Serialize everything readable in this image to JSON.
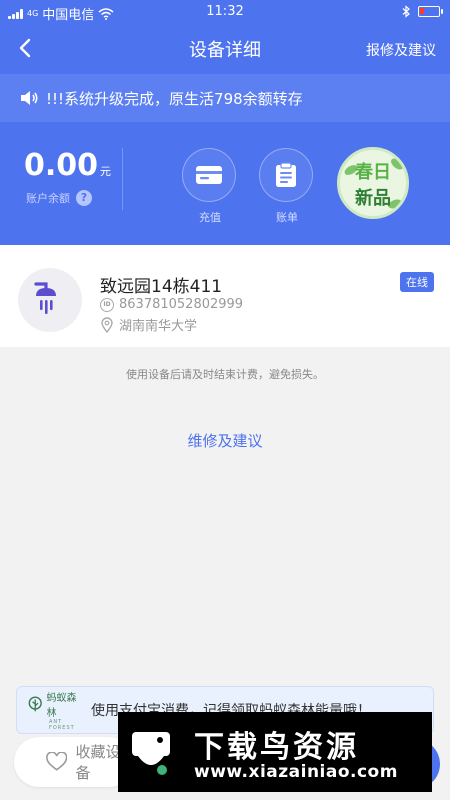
{
  "status_bar": {
    "network": "4G",
    "carrier": "中国电信",
    "time": "11:32"
  },
  "nav": {
    "title": "设备详细",
    "repair_link": "报修及建议"
  },
  "notice": {
    "text": "!!!系统升级完成，原生活798余额转存"
  },
  "wallet": {
    "amount": "0.00",
    "unit": "元",
    "balance_label": "账户余额",
    "help": "?",
    "actions": [
      {
        "label": "充值",
        "icon": "card-icon"
      },
      {
        "label": "账单",
        "icon": "clipboard-icon"
      }
    ],
    "promo": {
      "line1": "春日",
      "line2": "新品"
    }
  },
  "device": {
    "name": "致远园14栋411",
    "status": "在线",
    "id_tag": "ID",
    "id": "863781052802999",
    "location": "湖南南华大学",
    "icon": "shower-icon"
  },
  "tip": "使用设备后请及时结束计费，避免损失。",
  "repair_suggest": "维修及建议",
  "ant_banner": {
    "logo_text": "蚂蚁森林",
    "logo_sub": "ANT FOREST",
    "text": "使用支付宝消费，记得领取蚂蚁森林能量哦！"
  },
  "favorite": {
    "label": "收藏设备"
  },
  "watermark": {
    "title": "下载鸟资源",
    "url": "www.xiazainiao.com"
  },
  "colors": {
    "primary": "#4d73ef",
    "notice_bg": "#5c80f1",
    "battery_low": "#ff3b30"
  }
}
